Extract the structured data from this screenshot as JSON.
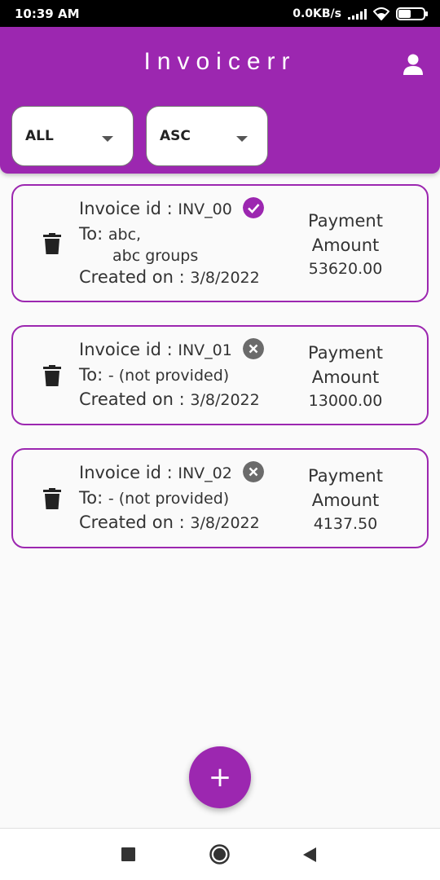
{
  "statusbar": {
    "time": "10:39 AM",
    "speed": "0.0KB/s",
    "battery": "47"
  },
  "appbar": {
    "title": "Invoicerr"
  },
  "filters": {
    "status": "ALL",
    "order": "ASC"
  },
  "labels": {
    "invoice_id": "Invoice id :",
    "to": "To:",
    "created_on": "Created on :",
    "payment_amount_line1": "Payment",
    "payment_amount_line2": "Amount"
  },
  "invoices": [
    {
      "id": "INV_00",
      "to_line1": "abc,",
      "to_line2": "abc groups",
      "created": "3/8/2022",
      "amount": "53620.00",
      "paid": true
    },
    {
      "id": "INV_01",
      "to_line1": "- (not provided)",
      "to_line2": "",
      "created": "3/8/2022",
      "amount": "13000.00",
      "paid": false
    },
    {
      "id": "INV_02",
      "to_line1": "- (not provided)",
      "to_line2": "",
      "created": "3/8/2022",
      "amount": "4137.50",
      "paid": false
    }
  ],
  "fab": {
    "label": "+"
  },
  "colors": {
    "primary": "#9c27b0",
    "unpaid_icon": "#6b6b6b"
  }
}
